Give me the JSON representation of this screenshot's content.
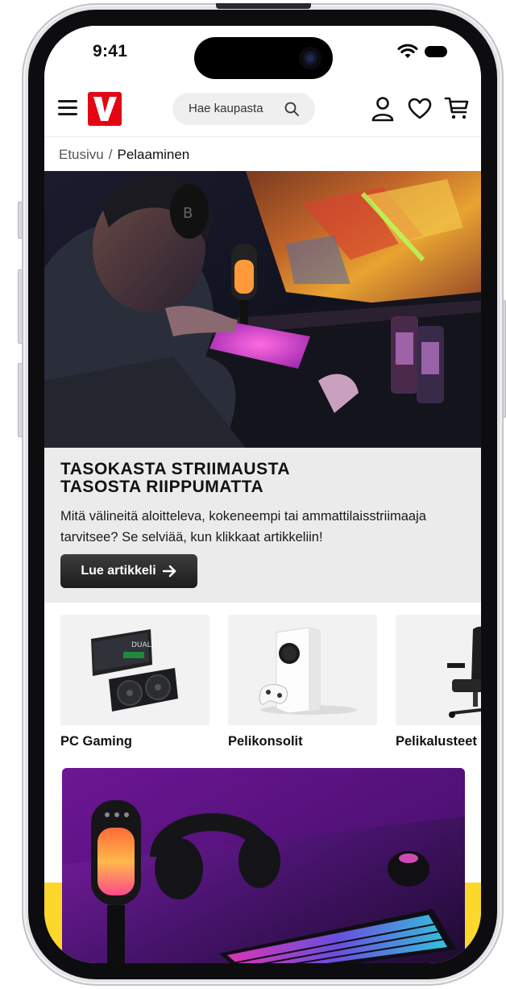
{
  "status_bar": {
    "time": "9:41"
  },
  "header": {
    "search_placeholder": "Hae kaupasta",
    "icons": [
      "menu-icon",
      "logo-v",
      "search-icon",
      "user-icon",
      "heart-icon",
      "cart-icon"
    ],
    "brand_color": "#e30613"
  },
  "breadcrumb": {
    "home": "Etusivu",
    "separator": "/",
    "current": "Pelaaminen"
  },
  "hero": {
    "title_line1": "TASOKASTA STRIIMAUSTA",
    "title_line2": "TASOSTA RIIPPUMATTA",
    "text": "Mitä välineitä aloitteleva, kokeneempi tai ammattilaisstriimaaja tarvitsee? Se selviää, kun klikkaat artikkeliin!",
    "button_label": "Lue artikkeli"
  },
  "categories": [
    {
      "label": "PC Gaming",
      "image": "graphics-card"
    },
    {
      "label": "Pelikonsolit",
      "image": "game-console"
    },
    {
      "label": "Pelikalusteet",
      "image": "gaming-chair"
    }
  ],
  "colors": {
    "accent_yellow": "#fcd72c",
    "button_dark": "#2a2a2a",
    "panel_gray": "#ebebeb"
  }
}
